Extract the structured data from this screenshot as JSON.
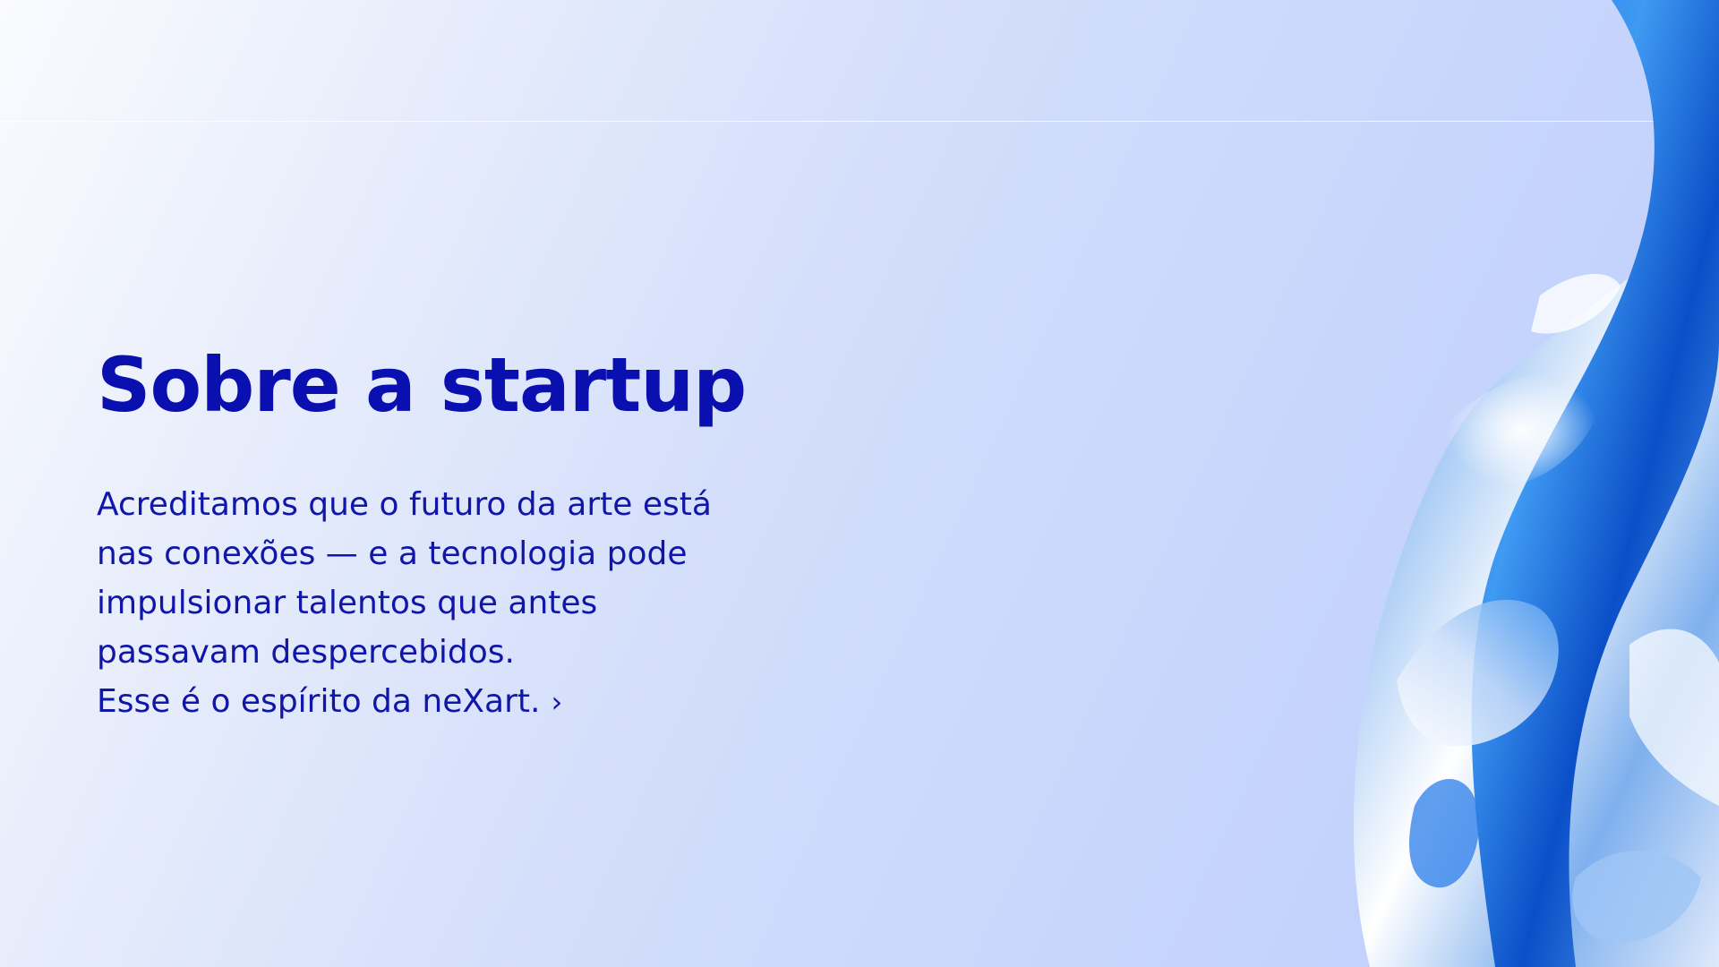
{
  "section": {
    "title": "Sobre a startup",
    "body_lines": [
      " Acreditamos que o futuro da arte está",
      "nas conexões — e a tecnologia pode",
      "impulsionar talentos que antes",
      "passavam despercebidos.",
      "Esse é o espírito da neXart."
    ],
    "more_icon": "chevron-right-icon",
    "more_glyph": "›"
  },
  "art": {
    "icon": "liquid-chrome-shape"
  },
  "colors": {
    "title": "#0a0fb0",
    "text": "#1016a8",
    "accent": "#1565e6",
    "background_start": "#fafbfe",
    "background_end": "#bccdfb"
  }
}
